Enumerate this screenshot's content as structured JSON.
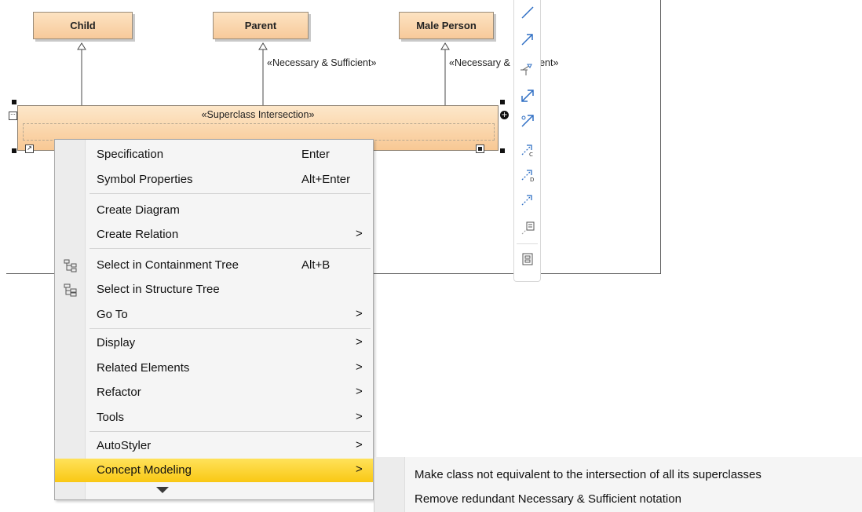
{
  "diagram": {
    "classes": {
      "child": "Child",
      "parent": "Parent",
      "male_person": "Male Person"
    },
    "edge_labels": {
      "parent_nec_suff": "«Necessary & Sufficient»",
      "male_nec_suff": "«Necessary & Sufficient»"
    },
    "intersection_stereotype": "«Superclass Intersection»"
  },
  "toolbar": {
    "icons": [
      "line-icon",
      "directed-line-icon",
      "generalization-icon",
      "bidirectional-arrow-icon",
      "association-arrow-icon",
      "dependency-c-icon",
      "dependency-d-icon",
      "dashed-arrow-icon",
      "note-anchor-icon",
      "diagram-layout-icon"
    ]
  },
  "context_menu": {
    "items": [
      {
        "label": "Specification",
        "shortcut": "Enter"
      },
      {
        "label": "Symbol Properties",
        "shortcut": "Alt+Enter"
      },
      {
        "label": "Create Diagram"
      },
      {
        "label": "Create Relation",
        "arrow": ">"
      },
      {
        "label": "Select in Containment Tree",
        "shortcut": "Alt+B",
        "icon": "containment-tree-icon"
      },
      {
        "label": "Select in Structure Tree",
        "icon": "structure-tree-icon"
      },
      {
        "label": "Go To",
        "arrow": ">"
      },
      {
        "label": "Display",
        "arrow": ">"
      },
      {
        "label": "Related Elements",
        "arrow": ">"
      },
      {
        "label": "Refactor",
        "arrow": ">"
      },
      {
        "label": "Tools",
        "arrow": ">"
      },
      {
        "label": "AutoStyler",
        "arrow": ">"
      },
      {
        "label": "Concept Modeling",
        "arrow": ">",
        "highlighted": true
      }
    ],
    "highlight_color": "#fbd32f"
  },
  "submenu": {
    "items": [
      "Make class not equivalent to the intersection of all its superclasses",
      "Remove redundant Necessary & Sufficient notation"
    ]
  }
}
